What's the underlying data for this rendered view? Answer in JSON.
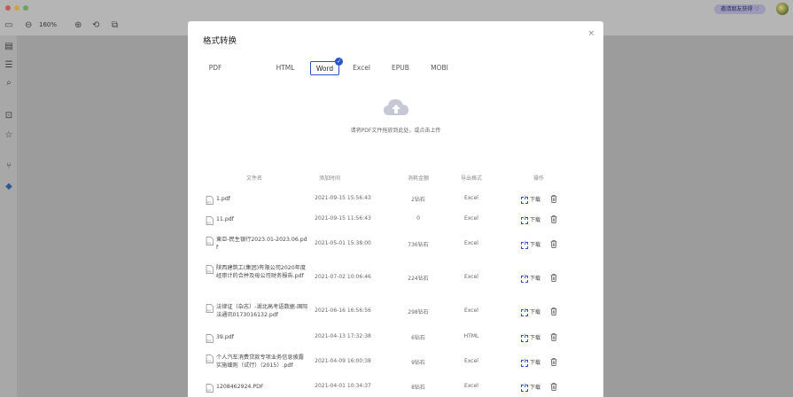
{
  "toolbar": {
    "zoom": "160%",
    "invite_label": "邀请朋友获得 ♡"
  },
  "modal": {
    "title": "格式转换",
    "close": "×",
    "tabs": [
      {
        "label": "PDF",
        "active": false
      },
      {
        "label": "HTML",
        "active": false
      },
      {
        "label": "Word",
        "active": true
      },
      {
        "label": "Excel",
        "active": false
      },
      {
        "label": "EPUB",
        "active": false
      },
      {
        "label": "MOBI",
        "active": false
      }
    ],
    "active_check": "✓",
    "upload_hint": "请将PDF文件拖放到此处，或点击上传"
  },
  "table": {
    "headers": [
      "文件名",
      "添加时间",
      "消耗金额",
      "导出格式",
      "操作"
    ],
    "download_label": "下载",
    "rows": [
      {
        "name": "1.pdf",
        "time": "2021-09-15 15:56:43",
        "cost": "2钻石",
        "format": "Excel"
      },
      {
        "name": "11.pdf",
        "time": "2021-09-15 11:56:43",
        "cost": "0",
        "format": "Excel"
      },
      {
        "name": "東亞-民生银行2023.01-2023.06.pdf",
        "time": "2021-05-01 15:38:00",
        "cost": "736钻石",
        "format": "Excel"
      },
      {
        "name": "陕西建筑工(集团)有限公司2020年度经审计的合并及母公司财务报告.pdf",
        "time": "2021-07-02 10:06:46",
        "cost": "224钻石",
        "format": "Excel"
      },
      {
        "name": "法律证（杂志）-湖北高考语数据-国际法通讯0173016132.pdf",
        "time": "2021-06-16 16:56:56",
        "cost": "298钻石",
        "format": "Excel"
      },
      {
        "name": "39.pdf",
        "time": "2021-04-13 17:32:38",
        "cost": "6钻石",
        "format": "HTML"
      },
      {
        "name": "个人汽车消费贷款专项业务信息披露实施细则（试行）（2015）.pdf",
        "time": "2021-04-09 16:00:38",
        "cost": "9钻石",
        "format": "Excel"
      },
      {
        "name": "1208462924.PDF",
        "time": "2021-04-01 10:34:37",
        "cost": "8钻石",
        "format": "Excel"
      }
    ]
  }
}
